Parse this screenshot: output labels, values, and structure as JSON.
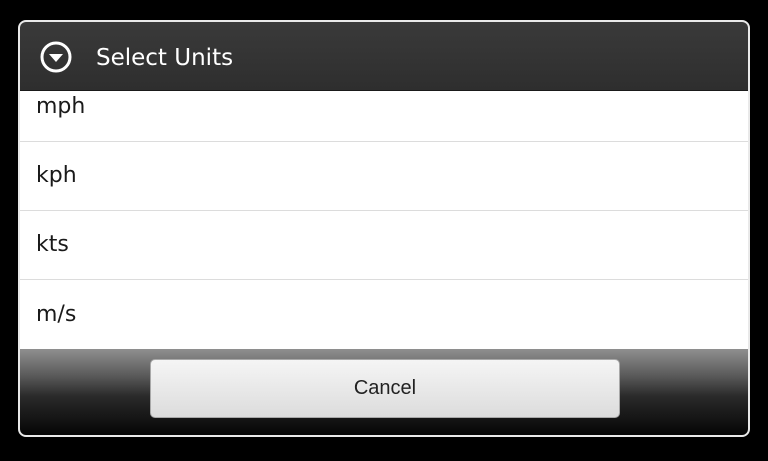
{
  "dialog": {
    "title": "Select Units",
    "title_icon": "chevron-down-circle-icon"
  },
  "units": {
    "items": [
      {
        "label": "mph"
      },
      {
        "label": "kph"
      },
      {
        "label": "kts"
      },
      {
        "label": "m/s"
      }
    ]
  },
  "footer": {
    "cancel_label": "Cancel"
  },
  "colors": {
    "titlebar_bg": "#333333",
    "title_text": "#ffffff",
    "list_bg": "#ffffff",
    "divider": "#dcdcdc"
  }
}
